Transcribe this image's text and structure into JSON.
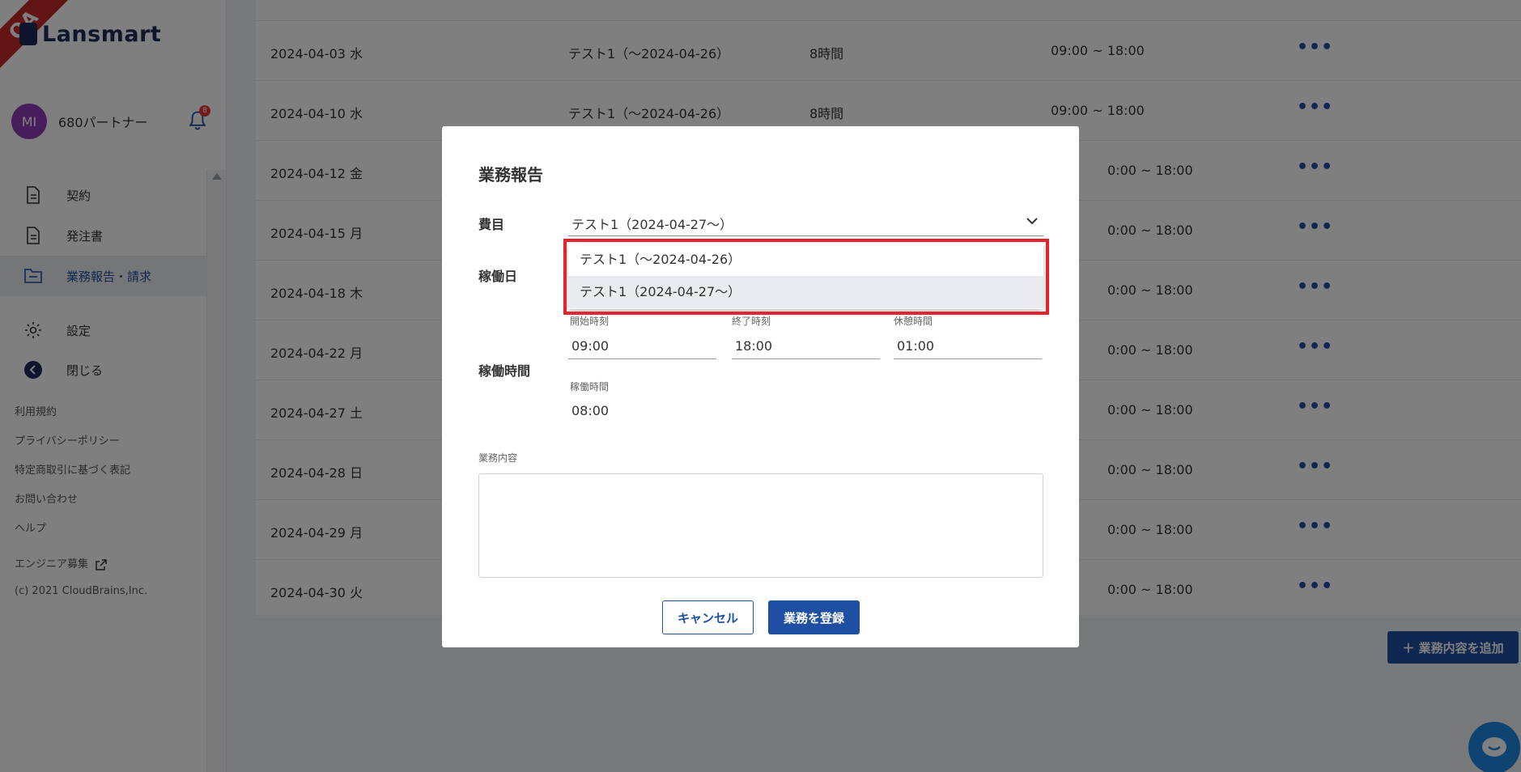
{
  "app": {
    "logo_text": "Lansmart",
    "ribbon": "QA"
  },
  "user": {
    "avatar_initials": "MI",
    "name": "680パートナー",
    "notification_count": "8"
  },
  "sidebar": {
    "items": [
      {
        "label": "契約",
        "icon": "document-icon"
      },
      {
        "label": "発注書",
        "icon": "document-icon"
      },
      {
        "label": "業務報告・請求",
        "icon": "folder-icon",
        "active": true
      },
      {
        "label": "設定",
        "icon": "gear-icon"
      },
      {
        "label": "閉じる",
        "icon": "back-circle-icon"
      }
    ],
    "footer_links": [
      "利用規約",
      "プライバシーポリシー",
      "特定商取引に基づく表記",
      "お問い合わせ",
      "ヘルプ",
      "エンジニア募集"
    ],
    "copyright": "(c) 2021 CloudBrains,Inc."
  },
  "table": {
    "rows": [
      {
        "date": "2024-04-03 水",
        "name": "テスト1（〜2024-04-26）",
        "hours": "8時間",
        "time": "09:00 ~ 18:00"
      },
      {
        "date": "2024-04-10 水",
        "name": "テスト1（〜2024-04-26）",
        "hours": "8時間",
        "time": "09:00 ~ 18:00"
      },
      {
        "date": "2024-04-12 金",
        "name": "",
        "hours": "",
        "time": "0:00 ~ 18:00"
      },
      {
        "date": "2024-04-15 月",
        "name": "",
        "hours": "",
        "time": "0:00 ~ 18:00"
      },
      {
        "date": "2024-04-18 木",
        "name": "",
        "hours": "",
        "time": "0:00 ~ 18:00"
      },
      {
        "date": "2024-04-22 月",
        "name": "",
        "hours": "",
        "time": "0:00 ~ 18:00"
      },
      {
        "date": "2024-04-27 土",
        "name": "",
        "hours": "",
        "time": "0:00 ~ 18:00"
      },
      {
        "date": "2024-04-28 日",
        "name": "",
        "hours": "",
        "time": "0:00 ~ 18:00"
      },
      {
        "date": "2024-04-29 月",
        "name": "",
        "hours": "",
        "time": "0:00 ~ 18:00"
      },
      {
        "date": "2024-04-30 火",
        "name": "",
        "hours": "",
        "time": "0:00 ~ 18:00"
      }
    ],
    "more_glyph": "•••",
    "add_button": "＋ 業務内容を追加"
  },
  "modal": {
    "title": "業務報告",
    "expense_label": "費目",
    "expense_value": "テスト1（2024-04-27〜）",
    "dropdown_options": [
      "テスト1（〜2024-04-26）",
      "テスト1（2024-04-27〜）"
    ],
    "workday_label": "稼働日",
    "worktime_label": "稼働時間",
    "start_label": "開始時刻",
    "start_value": "09:00",
    "end_label": "終了時刻",
    "end_value": "18:00",
    "break_label": "休憩時間",
    "break_value": "01:00",
    "worktime_sub_label": "稼働時間",
    "worktime_value": "08:00",
    "content_label": "業務内容",
    "cancel_label": "キャンセル",
    "submit_label": "業務を登録"
  },
  "colors": {
    "primary": "#1e4fa3",
    "highlight": "#e5232d",
    "avatar": "#8e3bb7"
  }
}
